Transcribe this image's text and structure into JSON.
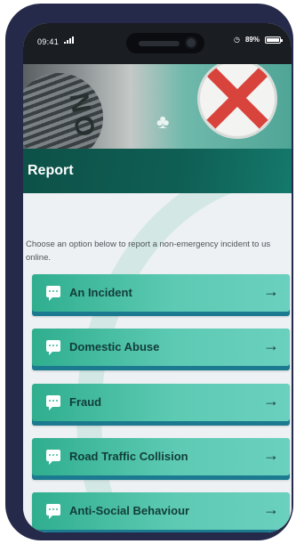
{
  "status_bar": {
    "time": "09:41",
    "battery": "89%"
  },
  "page": {
    "title": "Report",
    "intro": "Choose an option below to report a non-emergency incident to us online."
  },
  "options": [
    {
      "label": "An Incident"
    },
    {
      "label": "Domestic Abuse"
    },
    {
      "label": "Fraud"
    },
    {
      "label": "Road Traffic Collision"
    },
    {
      "label": "Anti-Social Behaviour"
    }
  ],
  "hero": {
    "emblem_letters": "NO"
  },
  "icons": {
    "option_icon": "chat-bubble-icon",
    "arrow_icon": "arrow-right-icon",
    "alarm_icon": "alarm-clock-icon"
  },
  "colors": {
    "header_band": "#0f5f55",
    "button_accent": "#2fae8e",
    "button_underline": "#1b7a8f",
    "phone_frame": "#262a4a"
  }
}
